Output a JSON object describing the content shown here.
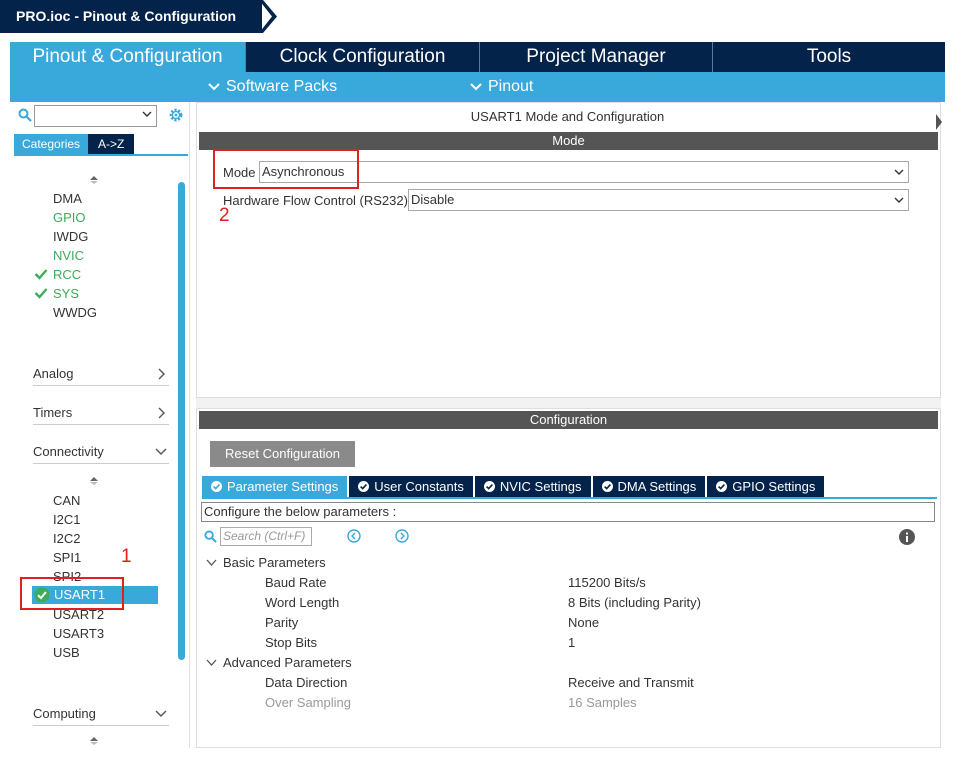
{
  "window": {
    "title": "PRO.ioc - Pinout & Configuration"
  },
  "main_tabs": [
    {
      "label": "Pinout & Configuration",
      "active": true
    },
    {
      "label": "Clock Configuration",
      "active": false
    },
    {
      "label": "Project Manager",
      "active": false
    },
    {
      "label": "Tools",
      "active": false
    }
  ],
  "sub_menu": {
    "software_packs": "Software Packs",
    "pinout": "Pinout"
  },
  "left": {
    "search": {
      "value": ""
    },
    "category_tabs": [
      "Categories",
      "A->Z"
    ],
    "system_core_items": [
      {
        "label": "DMA",
        "status": "none"
      },
      {
        "label": "GPIO",
        "status": "green"
      },
      {
        "label": "IWDG",
        "status": "none"
      },
      {
        "label": "NVIC",
        "status": "green"
      },
      {
        "label": "RCC",
        "status": "checked"
      },
      {
        "label": "SYS",
        "status": "checked"
      },
      {
        "label": "WWDG",
        "status": "none"
      }
    ],
    "groups": {
      "analog": "Analog",
      "timers": "Timers",
      "connectivity": "Connectivity",
      "computing": "Computing"
    },
    "connectivity_items": [
      {
        "label": "CAN"
      },
      {
        "label": "I2C1"
      },
      {
        "label": "I2C2"
      },
      {
        "label": "SPI1"
      },
      {
        "label": "SPI2"
      },
      {
        "label": "USART1",
        "selected": true
      },
      {
        "label": "USART2"
      },
      {
        "label": "USART3"
      },
      {
        "label": "USB"
      }
    ],
    "annotation_1": "1"
  },
  "mode": {
    "panel_title": "USART1 Mode and Configuration",
    "header": "Mode",
    "mode_label": "Mode",
    "mode_value": "Asynchronous",
    "flow_label": "Hardware Flow Control (RS232)",
    "flow_value": "Disable",
    "annotation_2": "2"
  },
  "configuration": {
    "header": "Configuration",
    "reset_label": "Reset Configuration",
    "tabs": [
      {
        "label": "Parameter Settings",
        "active": true
      },
      {
        "label": "User Constants",
        "active": false
      },
      {
        "label": "NVIC Settings",
        "active": false
      },
      {
        "label": "DMA Settings",
        "active": false
      },
      {
        "label": "GPIO Settings",
        "active": false
      }
    ],
    "description": "Configure the below parameters :",
    "search_placeholder": "Search (Ctrl+F)",
    "basic_title": "Basic Parameters",
    "basic": [
      {
        "name": "Baud Rate",
        "value": "115200 Bits/s"
      },
      {
        "name": "Word Length",
        "value": "8 Bits (including Parity)"
      },
      {
        "name": "Parity",
        "value": "None"
      },
      {
        "name": "Stop Bits",
        "value": "1"
      }
    ],
    "advanced_title": "Advanced Parameters",
    "advanced": [
      {
        "name": "Data Direction",
        "value": "Receive and Transmit",
        "dim": false
      },
      {
        "name": "Over Sampling",
        "value": "16 Samples",
        "dim": true
      }
    ]
  },
  "colors": {
    "navy": "#03234b",
    "accent_blue": "#39a9dc",
    "check_green": "#3cab5a",
    "annotation_red": "#e02020"
  }
}
